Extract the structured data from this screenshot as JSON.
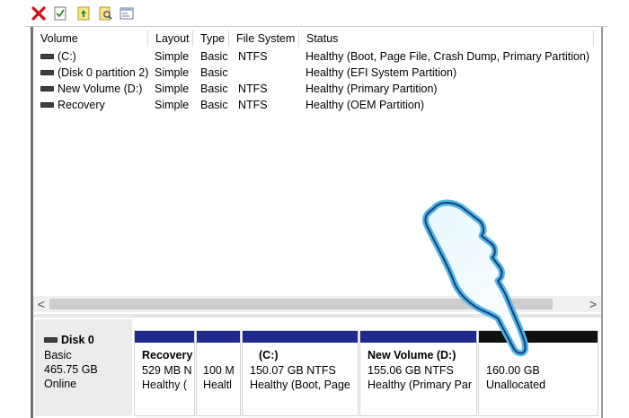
{
  "toolbar": {
    "icons": [
      "delete-icon",
      "properties-icon",
      "help-icon",
      "explore-icon",
      "console-icon"
    ]
  },
  "volume_list": {
    "columns": [
      "Volume",
      "Layout",
      "Type",
      "File System",
      "Status"
    ],
    "rows": [
      {
        "volume": "(C:)",
        "layout": "Simple",
        "type": "Basic",
        "fs": "NTFS",
        "status": "Healthy (Boot, Page File, Crash Dump, Primary Partition)"
      },
      {
        "volume": "(Disk 0 partition 2)",
        "layout": "Simple",
        "type": "Basic",
        "fs": "",
        "status": "Healthy (EFI System Partition)"
      },
      {
        "volume": "New Volume (D:)",
        "layout": "Simple",
        "type": "Basic",
        "fs": "NTFS",
        "status": "Healthy (Primary Partition)"
      },
      {
        "volume": "Recovery",
        "layout": "Simple",
        "type": "Basic",
        "fs": "NTFS",
        "status": "Healthy (OEM Partition)"
      }
    ],
    "scroll_left": "<",
    "scroll_right": ">"
  },
  "disk": {
    "name": "Disk 0",
    "type": "Basic",
    "size": "465.75 GB",
    "state": "Online",
    "partitions": [
      {
        "name": "Recovery",
        "size": "529 MB N",
        "status": "Healthy (",
        "bar": "#1e2a8c"
      },
      {
        "name": "",
        "size": "100 M",
        "status": "Healtl",
        "bar": "#1e2a8c"
      },
      {
        "name": "(C:)",
        "size": "150.07 GB NTFS",
        "status": "Healthy (Boot, Page",
        "bar": "#1e2a8c"
      },
      {
        "name": "New Volume  (D:)",
        "size": "155.06 GB NTFS",
        "status": "Healthy (Primary Par",
        "bar": "#1e2a8c"
      },
      {
        "name": "",
        "size": "160.00 GB",
        "status": "Unallocated",
        "bar": "#111111"
      }
    ]
  },
  "colors": {
    "primary_partition_bar": "#1e2a8c",
    "unallocated_bar": "#111111",
    "hand_cursor_glow": "#4fb6e8"
  }
}
